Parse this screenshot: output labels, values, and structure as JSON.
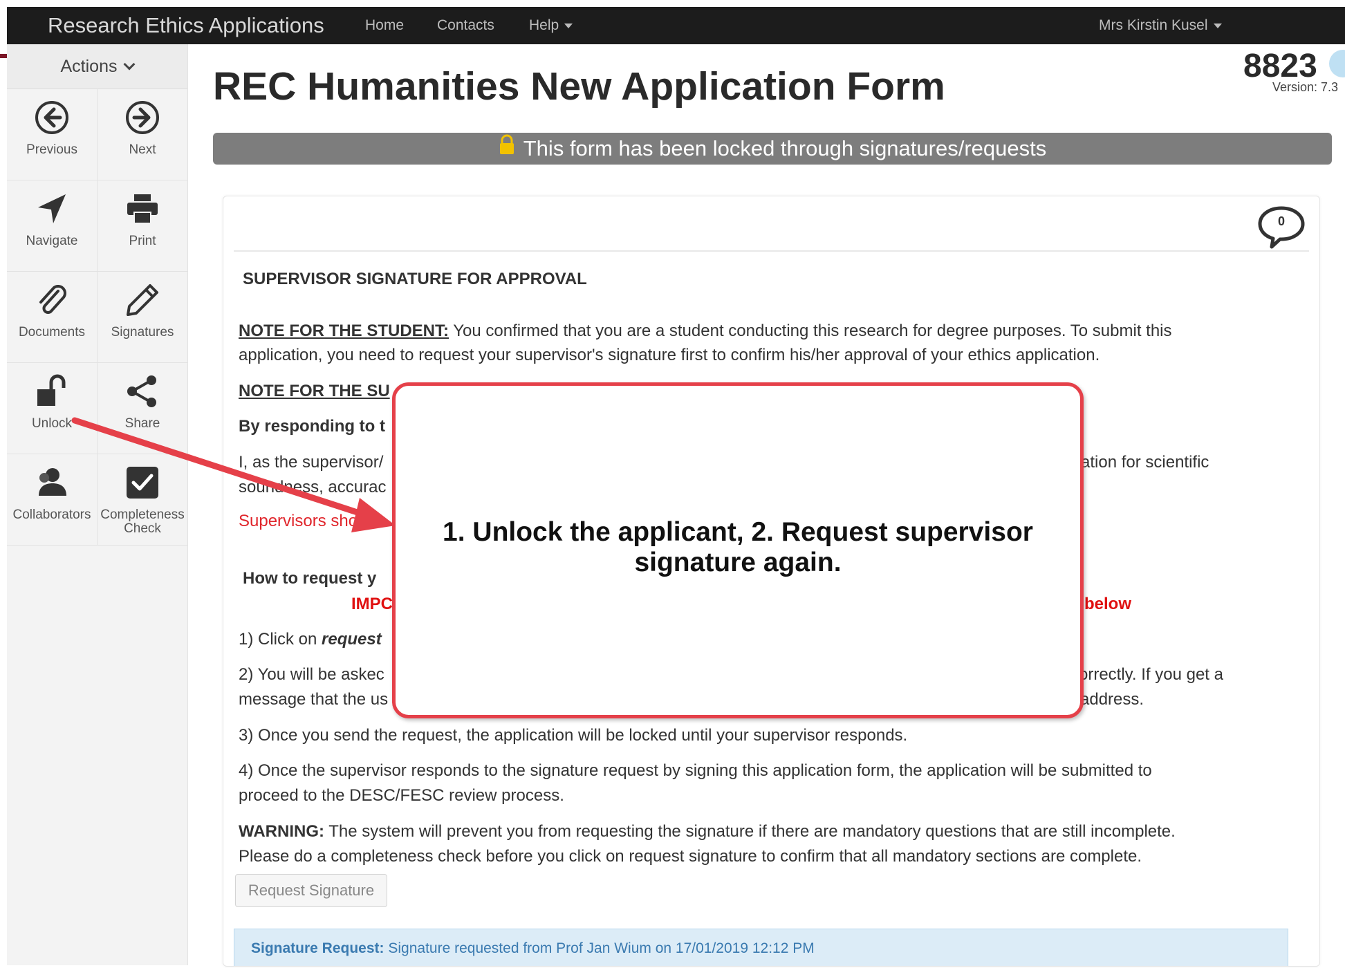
{
  "navbar": {
    "brand": "Research Ethics Applications",
    "home": "Home",
    "contacts": "Contacts",
    "help": "Help",
    "user": "Mrs Kirstin Kusel"
  },
  "sidebar": {
    "header": "Actions",
    "tiles": [
      {
        "label": "Previous",
        "icon": "arrow-left-circle-icon"
      },
      {
        "label": "Next",
        "icon": "arrow-right-circle-icon"
      },
      {
        "label": "Navigate",
        "icon": "navigate-arrow-icon"
      },
      {
        "label": "Print",
        "icon": "printer-icon"
      },
      {
        "label": "Documents",
        "icon": "paperclip-icon"
      },
      {
        "label": "Signatures",
        "icon": "pencil-icon"
      },
      {
        "label": "Unlock",
        "icon": "unlock-icon"
      },
      {
        "label": "Share",
        "icon": "share-icon"
      },
      {
        "label": "Collaborators",
        "icon": "users-icon"
      },
      {
        "label": "Completeness",
        "label2": "Check",
        "icon": "checkbox-icon"
      }
    ]
  },
  "page": {
    "title": "REC Humanities New Application Form",
    "app_number": "8823",
    "version": "Version: 7.3",
    "lock_banner": "This form has been locked through signatures/requests"
  },
  "comments": {
    "count": "0"
  },
  "section": {
    "heading": "SUPERVISOR SIGNATURE FOR APPROVAL",
    "note_student_label": "NOTE FOR THE STUDENT:",
    "note_student_line1": " You confirmed that you are a student conducting this research for degree purposes. To submit this",
    "note_student_line2": "application, you need to request your supervisor's signature first to confirm his/her approval of your ethics application.",
    "note_supervisor_partial": "NOTE FOR THE SU",
    "by_responding_partial": "By responding to t",
    "supervisor_line_partial": "I, as the supervisor/",
    "supervisor_line_right": "ation for scientific",
    "soundness_partial": "soundness, accurac",
    "supervisors_should_partial": "Supervisors should",
    "how_to_partial": "How to request y",
    "important_partial": "IMPC",
    "below_partial": "below",
    "step1_prefix": "1) Click on ",
    "step1_bold": "request",
    "step2_partial": "2) You will be askec",
    "step2_right": "orrectly. If you get a",
    "step2b_partial": "message that the us",
    "step2b_right": "address.",
    "step3": "3) Once you send the request, the application will be locked until your supervisor responds.",
    "step4_line1": "4) Once the supervisor responds to the signature request by signing this application form, the application will be submitted to",
    "step4_line2": "proceed to the DESC/FESC review process.",
    "warning_label": "WARNING:",
    "warning_line1": " The system will prevent you from requesting the signature if there are mandatory questions that are still incomplete.",
    "warning_line2": "Please do a completeness check before you click on request signature to confirm that all mandatory sections are complete.",
    "request_button": "Request Signature",
    "sig_request_label": "Signature Request:",
    "sig_request_text": " Signature requested from Prof Jan Wium on 17/01/2019 12:12 PM"
  },
  "callout": {
    "line1": "1. Unlock the applicant, 2. Request supervisor",
    "line2": "signature again."
  },
  "colors": {
    "navbar": "#1c1c1c",
    "lock_banner": "#7d7d7d",
    "callout_border": "#e54049",
    "red_text": "#e0252b",
    "signature_box": "#dcecf7"
  }
}
